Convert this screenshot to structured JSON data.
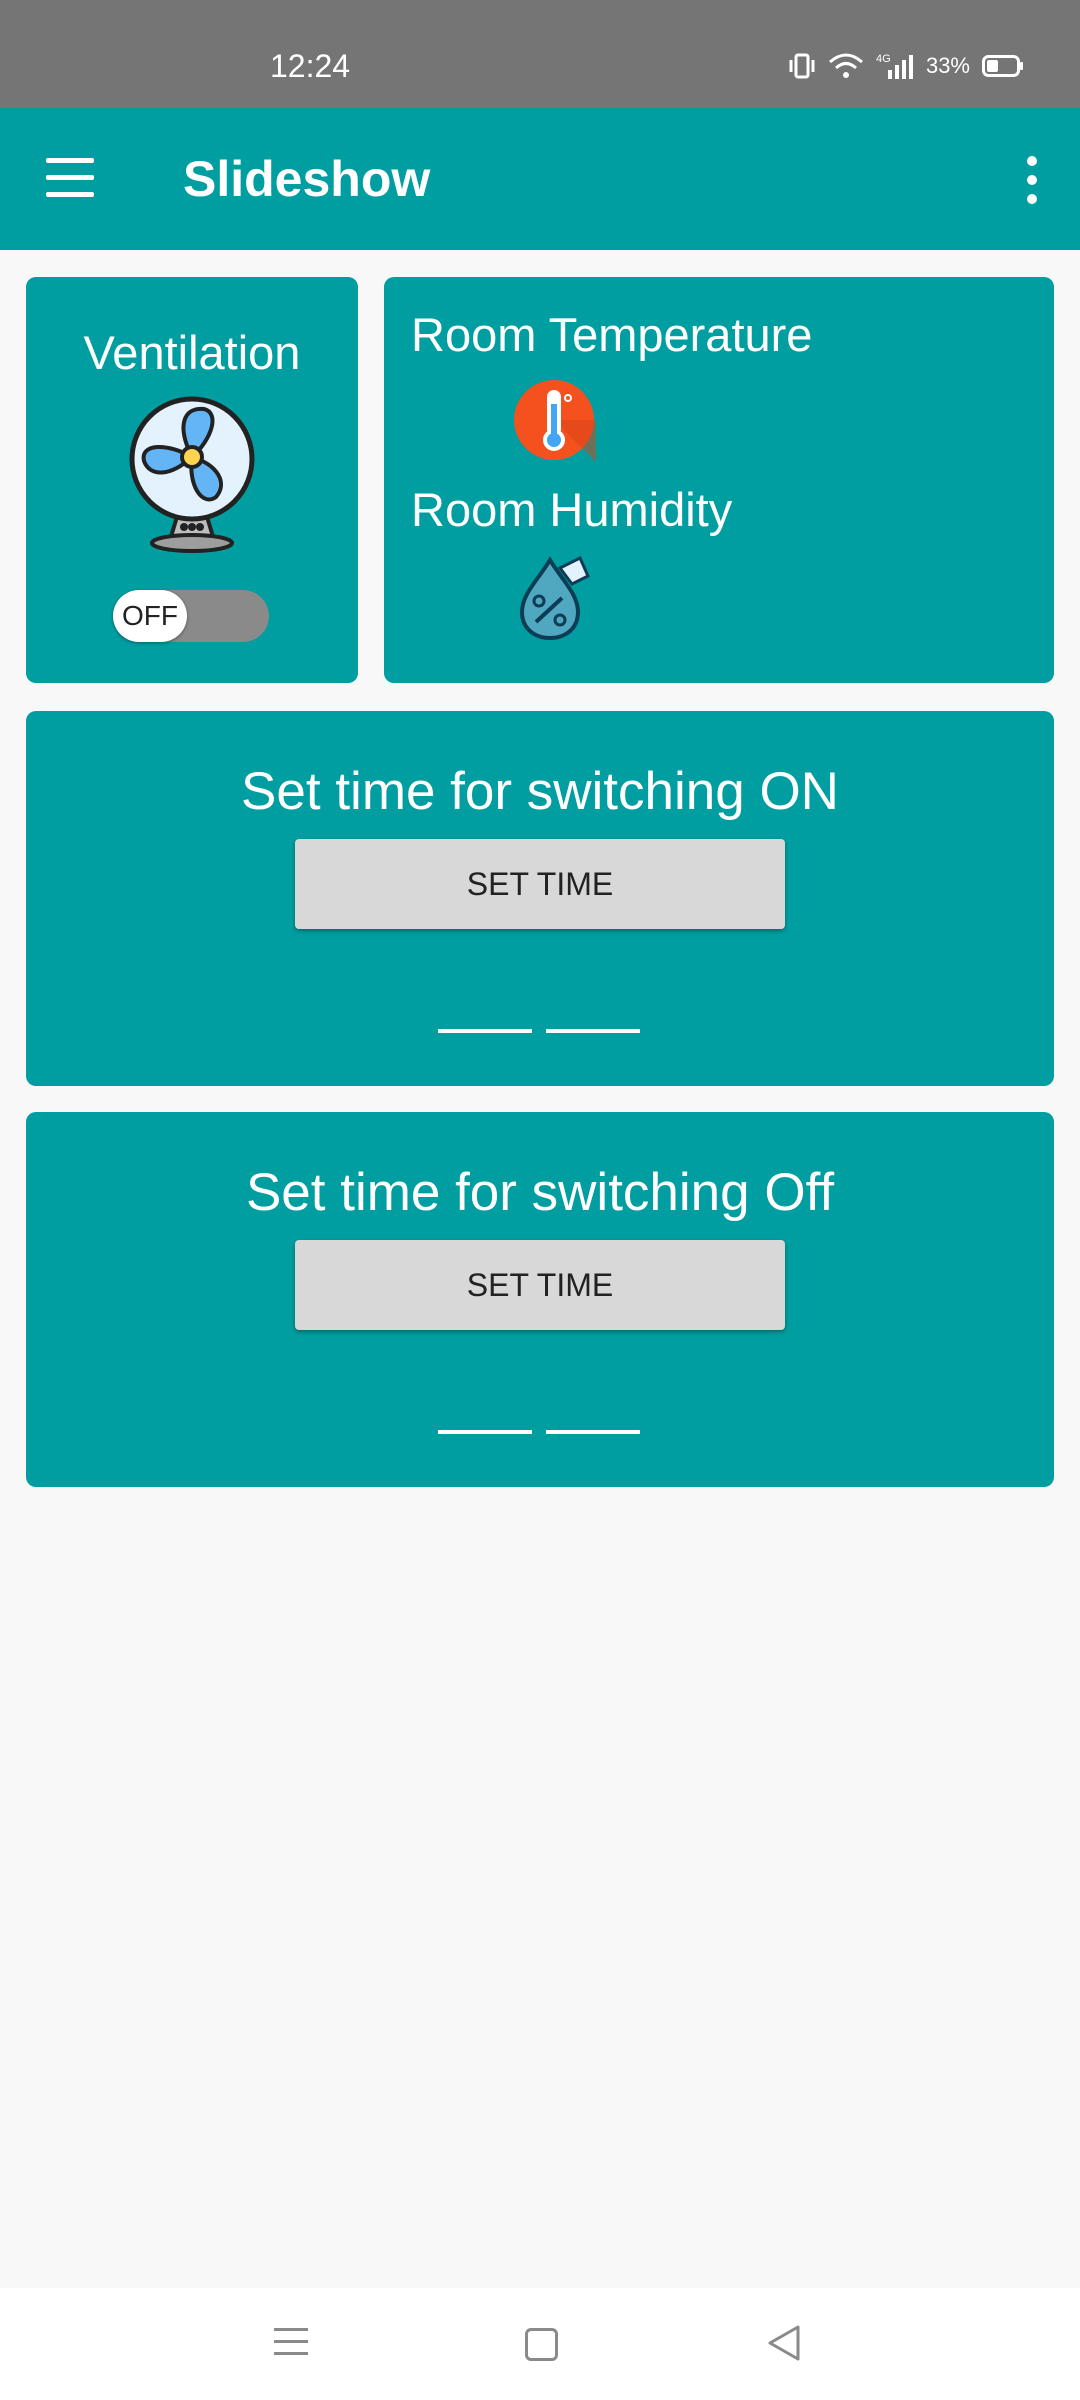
{
  "status_bar": {
    "time": "12:24",
    "battery": "33%",
    "icons": [
      "vibrate-icon",
      "wifi-icon",
      "signal-4g-icon",
      "battery-icon"
    ]
  },
  "app_bar": {
    "title": "Slideshow",
    "menu_icon": "menu-icon",
    "overflow_icon": "more-vert-icon"
  },
  "ventilation": {
    "title": "Ventilation",
    "icon": "fan-icon",
    "toggle_label": "OFF",
    "toggle_on": false
  },
  "sensors": {
    "temperature_label": "Room Temperature",
    "temperature_icon": "thermometer-icon",
    "humidity_label": "Room Humidity",
    "humidity_icon": "humidity-icon"
  },
  "timers": {
    "on": {
      "title": "Set time for switching ON",
      "button_label": "SET TIME"
    },
    "off": {
      "title": "Set time for switching Off",
      "button_label": "SET TIME"
    }
  },
  "nav_bar": {
    "icons": [
      "recents-icon",
      "home-icon",
      "back-icon"
    ]
  },
  "colors": {
    "accent": "#009ea0",
    "status_bar": "#757575",
    "button": "#d8d8d8",
    "background": "#f8f8f9"
  }
}
